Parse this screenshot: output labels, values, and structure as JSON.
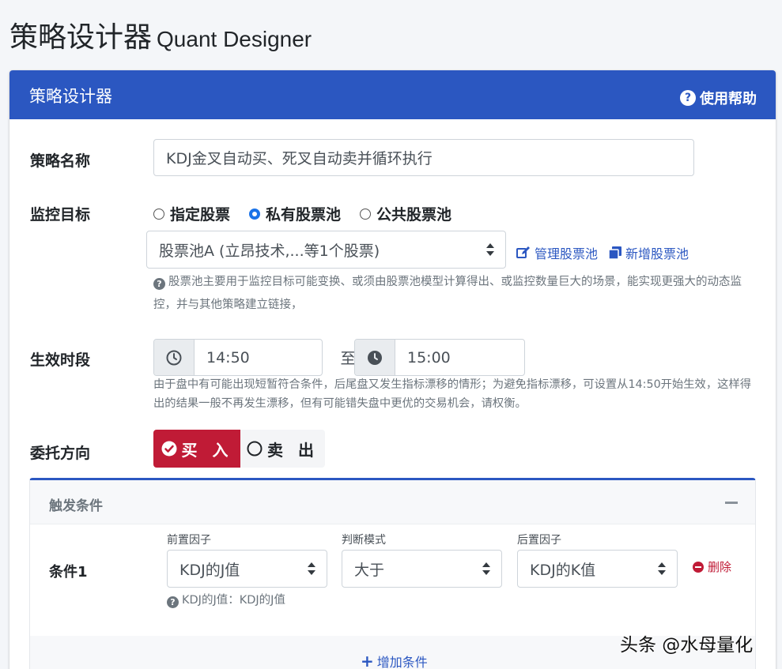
{
  "page": {
    "title": "策略设计器",
    "subtitle": "Quant Designer"
  },
  "card": {
    "title": "策略设计器",
    "help_label": "使用帮助",
    "help_glyph": "?"
  },
  "strategy_name": {
    "label": "策略名称",
    "value": "KDJ金叉自动买、死叉自动卖并循环执行"
  },
  "monitor": {
    "label": "监控目标",
    "options": [
      "指定股票",
      "私有股票池",
      "公共股票池"
    ],
    "selected_index": 1,
    "pool_select": "股票池A (立昂技术,...等1个股票)",
    "manage_link": "管理股票池",
    "new_link": "新增股票池",
    "hint": "股票池主要用于监控目标可能变换、或须由股票池模型计算得出、或监控数量巨大的场景，能实现更强大的动态监控，并与其他策略建立链接，"
  },
  "effective": {
    "label": "生效时段",
    "start": "14:50",
    "to": "至",
    "end": "15:00",
    "hint": "由于盘中有可能出现短暂符合条件，后尾盘又发生指标漂移的情形；为避免指标漂移，可设置从14:50开始生效，这样得出的结果一般不再发生漂移，但有可能错失盘中更优的交易机会，请权衡。"
  },
  "direction": {
    "label": "委托方向",
    "buy": "买 入",
    "sell": "卖 出",
    "selected": "buy"
  },
  "trigger": {
    "title": "触发条件",
    "condition_label": "条件1",
    "pre_factor_label": "前置因子",
    "pre_factor": "KDJ的J值",
    "mode_label": "判断模式",
    "mode": "大于",
    "post_factor_label": "后置因子",
    "post_factor": "KDJ的K值",
    "delete_label": "删除",
    "hint": "KDJ的J值：KDJ的J值",
    "add_label": "增加条件"
  },
  "watermark": "头条 @水母量化",
  "colors": {
    "primary": "#2b57c1",
    "danger": "#c01b36",
    "muted": "#6c757d"
  }
}
